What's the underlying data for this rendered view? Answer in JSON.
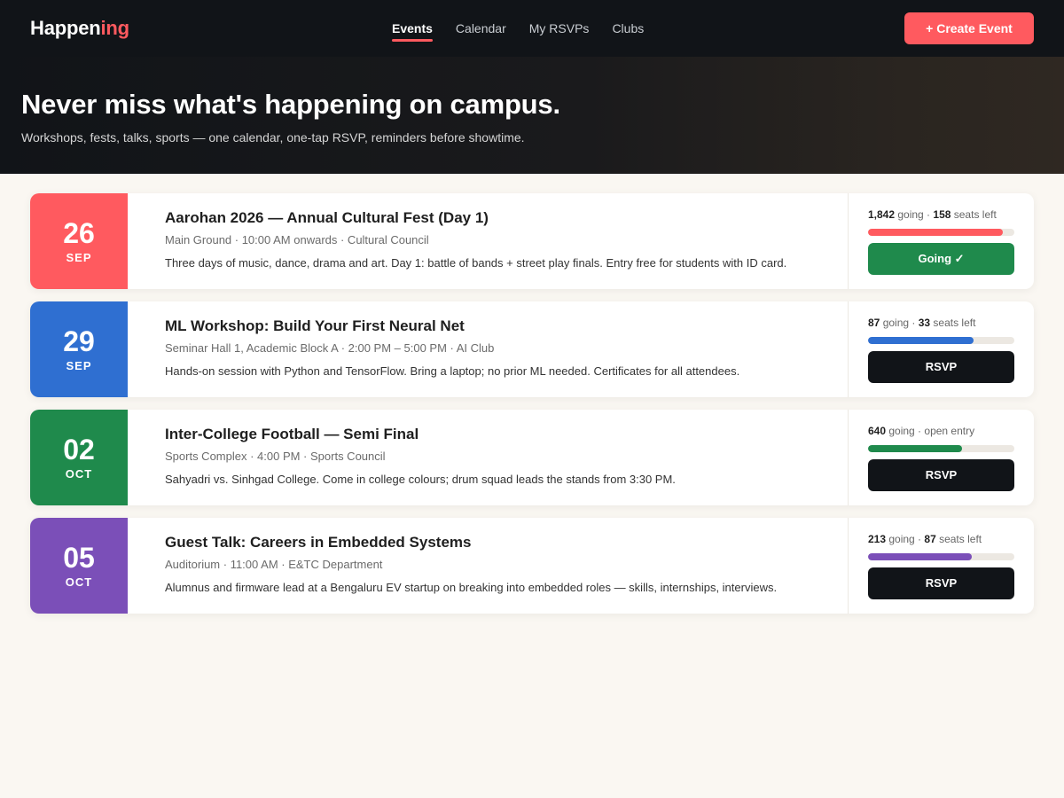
{
  "header": {
    "logo_main": "Happen",
    "logo_accent": "ing",
    "nav": [
      "Events",
      "Calendar",
      "My RSVPs",
      "Clubs"
    ],
    "active_nav": 0,
    "create_label": "+ Create Event"
  },
  "hero": {
    "title": "Never miss what's happening on campus.",
    "subtitle": "Workshops, fests, talks, sports — one calendar, one-tap RSVP, reminders before showtime."
  },
  "colors": {
    "accent": "#ff5a5f",
    "going_button": "#1f8a4c",
    "rsvp_button": "#111418"
  },
  "events": [
    {
      "day": "26",
      "month": "SEP",
      "color": "#ff5a5f",
      "title": "Aarohan 2026 — Annual Cultural Fest (Day 1)",
      "meta": "Main Ground · 10:00 AM onwards · Cultural Council",
      "desc": "Three days of music, dance, drama and art. Day 1: battle of bands + street play finals. Entry free for students with ID card.",
      "going": "1,842",
      "going_text": " going · ",
      "seats": "158",
      "seats_text": " seats left",
      "fill": 0.92,
      "button": "Going ✓",
      "state": "going"
    },
    {
      "day": "29",
      "month": "SEP",
      "color": "#2f6fd1",
      "title": "ML Workshop: Build Your First Neural Net",
      "meta": "Seminar Hall 1, Academic Block A · 2:00 PM – 5:00 PM · AI Club",
      "desc": "Hands-on session with Python and TensorFlow. Bring a laptop; no prior ML needed. Certificates for all attendees.",
      "going": "87",
      "going_text": " going · ",
      "seats": "33",
      "seats_text": " seats left",
      "fill": 0.72,
      "button": "RSVP",
      "state": "rsvp"
    },
    {
      "day": "02",
      "month": "OCT",
      "color": "#1f8a4c",
      "title": "Inter-College Football — Semi Final",
      "meta": "Sports Complex · 4:00 PM · Sports Council",
      "desc": "Sahyadri vs. Sinhgad College. Come in college colours; drum squad leads the stands from 3:30 PM.",
      "going": "640",
      "going_text": " going · open entry",
      "seats": "",
      "seats_text": "",
      "fill": 0.64,
      "button": "RSVP",
      "state": "rsvp"
    },
    {
      "day": "05",
      "month": "OCT",
      "color": "#7b4fb8",
      "title": "Guest Talk: Careers in Embedded Systems",
      "meta": "Auditorium · 11:00 AM · E&TC Department",
      "desc": "Alumnus and firmware lead at a Bengaluru EV startup on breaking into embedded roles — skills, internships, interviews.",
      "going": "213",
      "going_text": " going · ",
      "seats": "87",
      "seats_text": " seats left",
      "fill": 0.71,
      "button": "RSVP",
      "state": "rsvp"
    }
  ]
}
